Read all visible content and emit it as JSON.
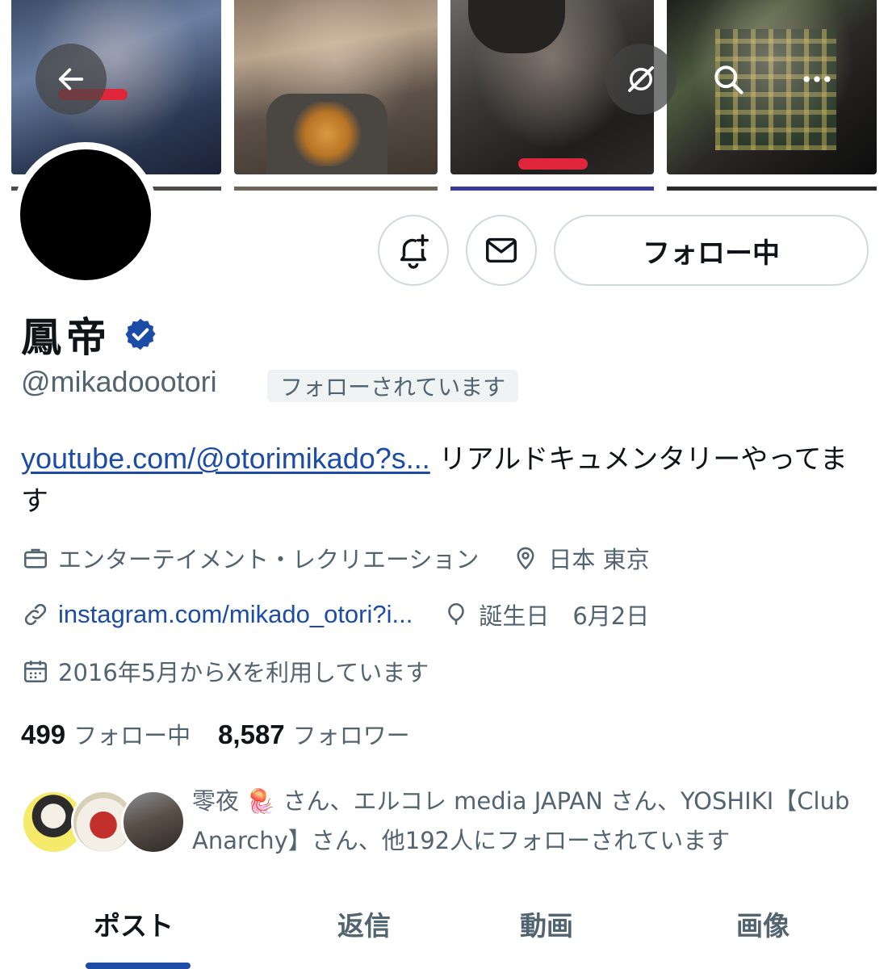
{
  "header": {
    "back_icon": "arrow-left-icon",
    "translate_icon": "grok-icon",
    "search_icon": "search-icon",
    "more_icon": "more-dots-icon"
  },
  "profile": {
    "name": "鳳帝",
    "handle": "@mikadoootori",
    "follows_you": "フォローされています",
    "verified_color": "#1d4ca6",
    "bio_link": "youtube.com/@otorimikado?s...",
    "bio_text": " リアルドキュメンタリーやってます",
    "category": "エンターテイメント・レクリエーション",
    "location": "日本 東京",
    "website": "instagram.com/mikado_otori?i...",
    "birthday": "誕生日　6月2日",
    "joined": "2016年5月からXを利用しています"
  },
  "actions": {
    "follow_label": "フォロー中",
    "notify_icon": "bell-plus-icon",
    "message_icon": "envelope-icon"
  },
  "stats": {
    "following_count": "499",
    "following_label": "フォロー中",
    "followers_count": "8,587",
    "followers_label": "フォロワー"
  },
  "known_followers": {
    "text": "零夜 🪼 さん、エルコレ media JAPAN さん、YOSHIKI【Club Anarchy】さん、他192人にフォローされています"
  },
  "tabs": [
    {
      "label": "ポスト",
      "active": true
    },
    {
      "label": "返信",
      "active": false
    },
    {
      "label": "動画",
      "active": false
    },
    {
      "label": "画像",
      "active": false
    }
  ],
  "colors": {
    "accent": "#1d4ca6",
    "secondary_text": "#536471",
    "primary_text": "#0f1419"
  }
}
